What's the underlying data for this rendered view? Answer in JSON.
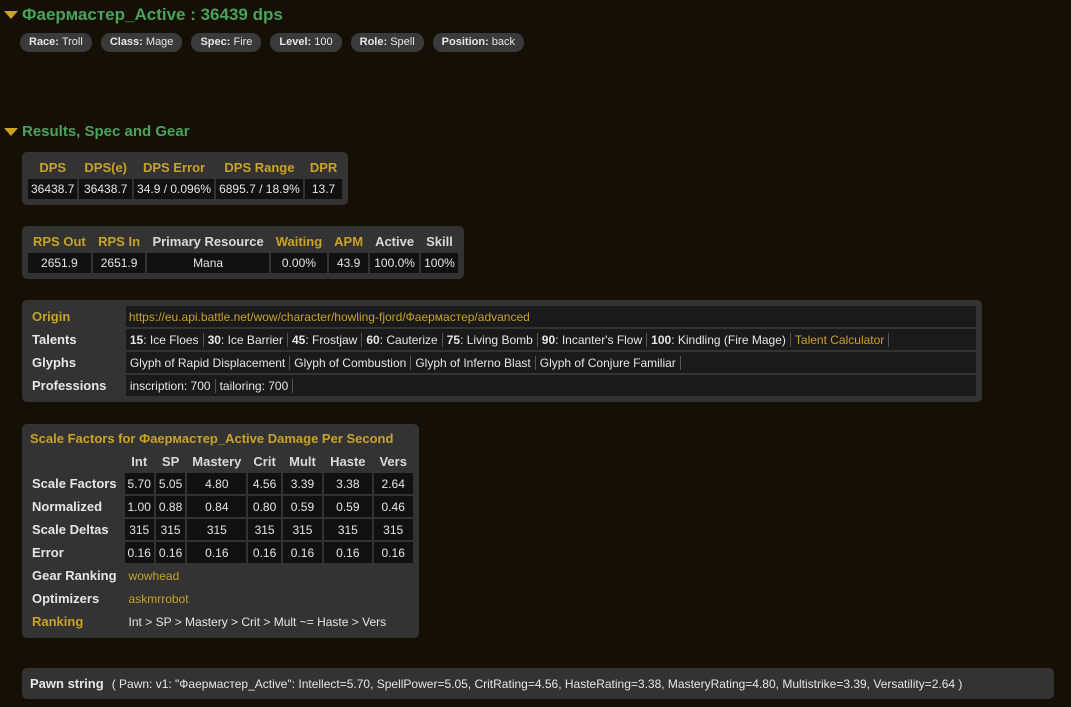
{
  "header": {
    "title": "Фаермастер_Active : 36439 dps",
    "pills": [
      {
        "label": "Race:",
        "value": "Troll"
      },
      {
        "label": "Class:",
        "value": "Mage"
      },
      {
        "label": "Spec:",
        "value": "Fire"
      },
      {
        "label": "Level:",
        "value": "100"
      },
      {
        "label": "Role:",
        "value": "Spell"
      },
      {
        "label": "Position:",
        "value": "back"
      }
    ]
  },
  "section": {
    "title": "Results, Spec and Gear"
  },
  "dps_table": {
    "headers": [
      "DPS",
      "DPS(e)",
      "DPS Error",
      "DPS Range",
      "DPR"
    ],
    "values": [
      "36438.7",
      "36438.7",
      "34.9 / 0.096%",
      "6895.7 / 18.9%",
      "13.7"
    ]
  },
  "rps_table": {
    "headers": [
      "RPS Out",
      "RPS In",
      "Primary Resource",
      "Waiting",
      "APM",
      "Active",
      "Skill"
    ],
    "values": [
      "2651.9",
      "2651.9",
      "Mana",
      "0.00%",
      "43.9",
      "100.0%",
      "100%"
    ]
  },
  "info": {
    "origin_label": "Origin",
    "origin_value": "https://eu.api.battle.net/wow/character/howling-fjord/Фаермастер/advanced",
    "talents_label": "Talents",
    "talents": [
      {
        "level": "15",
        "name": "Ice Floes"
      },
      {
        "level": "30",
        "name": "Ice Barrier"
      },
      {
        "level": "45",
        "name": "Frostjaw"
      },
      {
        "level": "60",
        "name": "Cauterize"
      },
      {
        "level": "75",
        "name": "Living Bomb"
      },
      {
        "level": "90",
        "name": "Incanter's Flow"
      },
      {
        "level": "100",
        "name": "Kindling (Fire Mage)"
      }
    ],
    "talent_calculator": "Talent Calculator",
    "glyphs_label": "Glyphs",
    "glyphs": [
      "Glyph of Rapid Displacement",
      "Glyph of Combustion",
      "Glyph of Inferno Blast",
      "Glyph of Conjure Familiar"
    ],
    "professions_label": "Professions",
    "professions": [
      "inscription: 700",
      "tailoring: 700"
    ]
  },
  "scale": {
    "title": "Scale Factors for Фаермастер_Active Damage Per Second",
    "columns": [
      "Int",
      "SP",
      "Mastery",
      "Crit",
      "Mult",
      "Haste",
      "Vers"
    ],
    "rows": [
      {
        "label": "Scale Factors",
        "values": [
          "5.70",
          "5.05",
          "4.80",
          "4.56",
          "3.39",
          "3.38",
          "2.64"
        ]
      },
      {
        "label": "Normalized",
        "values": [
          "1.00",
          "0.88",
          "0.84",
          "0.80",
          "0.59",
          "0.59",
          "0.46"
        ]
      },
      {
        "label": "Scale Deltas",
        "values": [
          "315",
          "315",
          "315",
          "315",
          "315",
          "315",
          "315"
        ]
      },
      {
        "label": "Error",
        "values": [
          "0.16",
          "0.16",
          "0.16",
          "0.16",
          "0.16",
          "0.16",
          "0.16"
        ]
      }
    ],
    "gear_ranking_label": "Gear Ranking",
    "gear_ranking_link": "wowhead",
    "optimizers_label": "Optimizers",
    "optimizers_link": "askmrrobot",
    "ranking_label": "Ranking",
    "ranking_value": "Int > SP > Mastery > Crit > Mult ~= Haste > Vers"
  },
  "pawn": {
    "label": "Pawn string",
    "value": "( Pawn: v1: \"Фаермастер_Active\": Intellect=5.70, SpellPower=5.05, CritRating=4.56, HasteRating=3.38, MasteryRating=4.80, Multistrike=3.39, Versatility=2.64 )"
  },
  "colors": {
    "background": "#160f05",
    "title_green": "#4aa35a",
    "accent_gold": "#c9a227",
    "panel": "#333333"
  }
}
